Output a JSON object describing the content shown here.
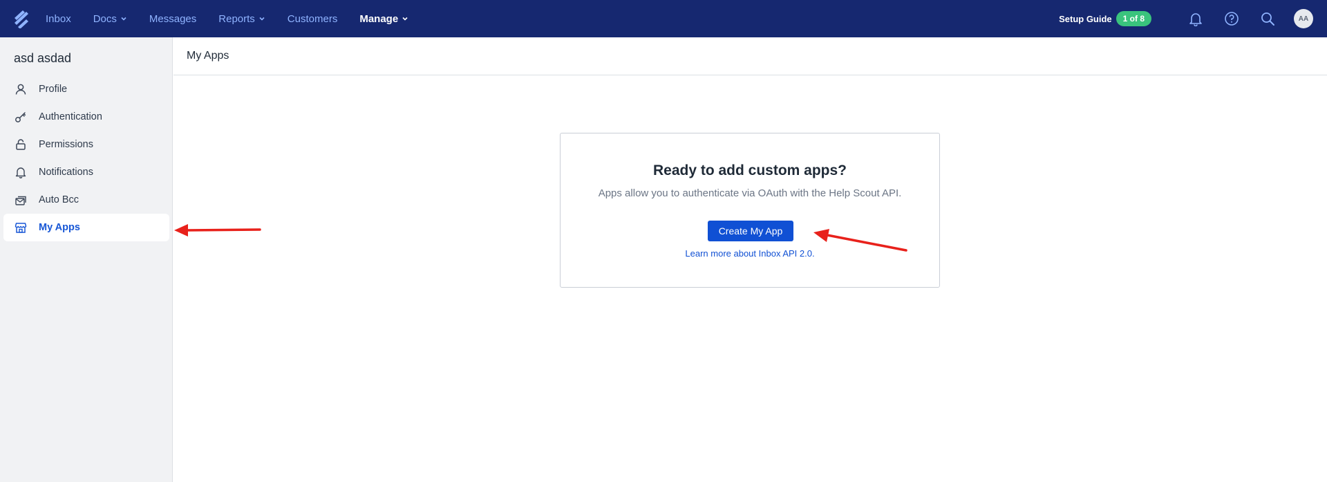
{
  "nav": {
    "items": [
      {
        "label": "Inbox",
        "has_dropdown": false,
        "active": false
      },
      {
        "label": "Docs",
        "has_dropdown": true,
        "active": false
      },
      {
        "label": "Messages",
        "has_dropdown": false,
        "active": false
      },
      {
        "label": "Reports",
        "has_dropdown": true,
        "active": false
      },
      {
        "label": "Customers",
        "has_dropdown": false,
        "active": false
      },
      {
        "label": "Manage",
        "has_dropdown": true,
        "active": true
      }
    ],
    "setup_guide_label": "Setup Guide",
    "setup_guide_progress": "1 of 8",
    "icons": [
      "bell-icon",
      "help-icon",
      "search-icon"
    ],
    "avatar_initials": "AA"
  },
  "sidebar": {
    "user_name": "asd asdad",
    "items": [
      {
        "label": "Profile",
        "icon": "person-icon",
        "active": false
      },
      {
        "label": "Authentication",
        "icon": "key-icon",
        "active": false
      },
      {
        "label": "Permissions",
        "icon": "lock-icon",
        "active": false
      },
      {
        "label": "Notifications",
        "icon": "bell-icon",
        "active": false
      },
      {
        "label": "Auto Bcc",
        "icon": "mail-stack-icon",
        "active": false
      },
      {
        "label": "My Apps",
        "icon": "apps-store-icon",
        "active": true
      }
    ]
  },
  "main": {
    "page_title": "My Apps",
    "card": {
      "title": "Ready to add custom apps?",
      "description": "Apps allow you to authenticate via OAuth with the Help Scout API.",
      "button_label": "Create My App",
      "link_text": "Learn more about Inbox API 2.0."
    }
  },
  "colors": {
    "topbar_bg": "#162870",
    "nav_link": "#8fb3ff",
    "accent_blue": "#1050d4",
    "badge_green": "#3ac47d",
    "sidebar_bg": "#f1f2f4",
    "annotation_red": "#e8211b"
  }
}
